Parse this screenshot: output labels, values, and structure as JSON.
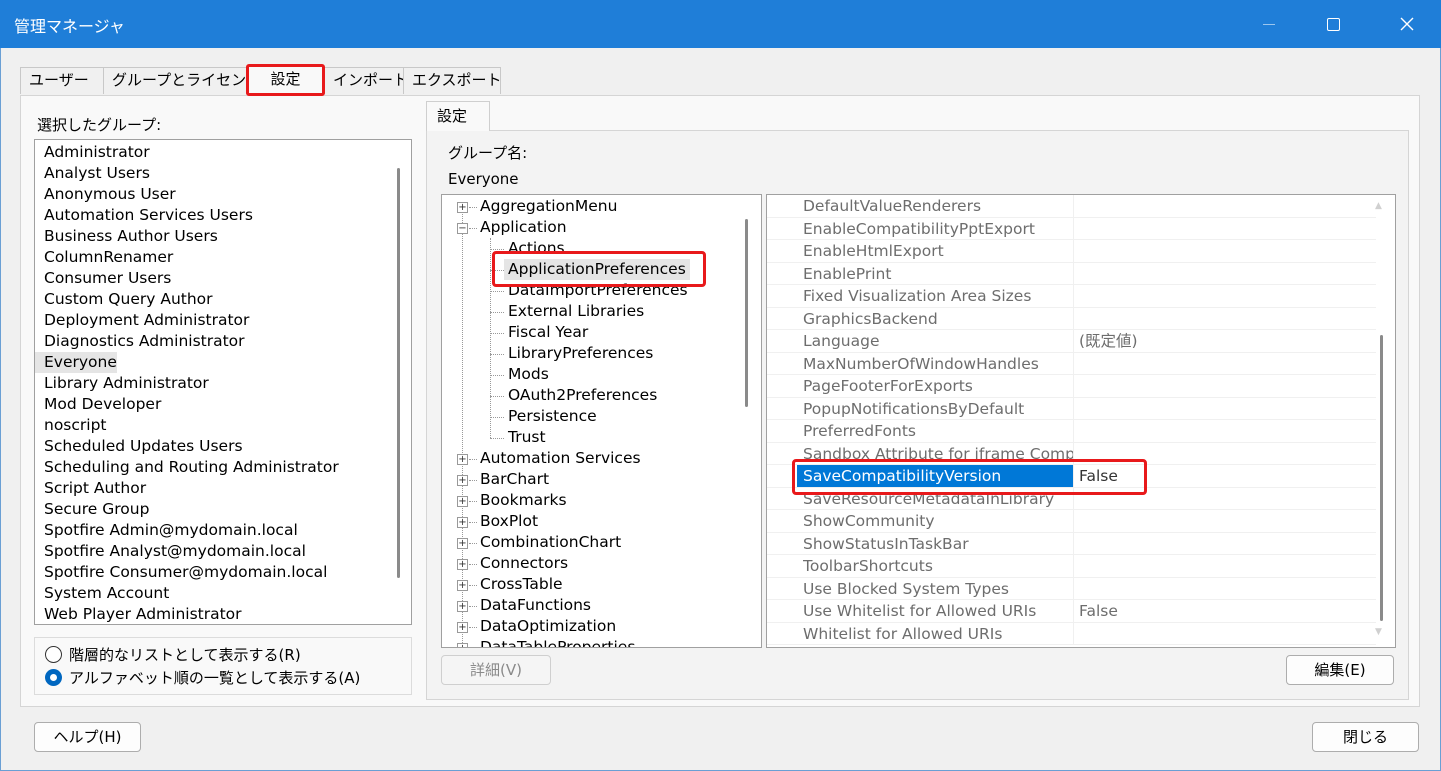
{
  "window": {
    "title": "管理マネージャ"
  },
  "tabs": [
    {
      "label": "ユーザー",
      "active": false
    },
    {
      "label": "グループとライセンス",
      "active": false
    },
    {
      "label": "設定",
      "active": true
    },
    {
      "label": "インポート",
      "active": false
    },
    {
      "label": "エクスポート",
      "active": false
    }
  ],
  "left": {
    "selected_groups_label": "選択したグループ:",
    "groups": [
      "Administrator",
      "Analyst Users",
      "Anonymous User",
      "Automation Services Users",
      "Business Author Users",
      "ColumnRenamer",
      "Consumer Users",
      "Custom Query Author",
      "Deployment Administrator",
      "Diagnostics Administrator",
      "Everyone",
      "Library Administrator",
      "Mod Developer",
      "noscript",
      "Scheduled Updates Users",
      "Scheduling and Routing Administrator",
      "Script Author",
      "Secure Group",
      "Spotfire Admin@mydomain.local",
      "Spotfire Analyst@mydomain.local",
      "Spotfire Consumer@mydomain.local",
      "System Account",
      "Web Player Administrator"
    ],
    "selected_group": "Everyone",
    "radio_hierarchical": "階層的なリストとして表示する(R)",
    "radio_alphabetical": "アルファベット順の一覧として表示する(A)",
    "radio_selected": "alphabetical"
  },
  "settings": {
    "tab_label": "設定",
    "group_name_label": "グループ名:",
    "group_name_value": "Everyone",
    "tree": {
      "aggregation_menu": "AggregationMenu",
      "application": "Application",
      "actions": "Actions",
      "application_preferences": "ApplicationPreferences",
      "data_import_preferences": "DataImportPreferences",
      "external_libraries": "External Libraries",
      "fiscal_year": "Fiscal Year",
      "library_preferences": "LibraryPreferences",
      "mods": "Mods",
      "oauth2_preferences": "OAuth2Preferences",
      "persistence": "Persistence",
      "trust": "Trust",
      "automation_services": "Automation Services",
      "bar_chart": "BarChart",
      "bookmarks": "Bookmarks",
      "box_plot": "BoxPlot",
      "combination_chart": "CombinationChart",
      "connectors": "Connectors",
      "cross_table": "CrossTable",
      "data_functions": "DataFunctions",
      "data_optimization": "DataOptimization",
      "data_table_properties": "DataTableProperties"
    },
    "tree_expanded": "Application",
    "tree_selected": "ApplicationPreferences",
    "properties": [
      {
        "name": "DefaultValueRenderers",
        "value": ""
      },
      {
        "name": "EnableCompatibilityPptExport",
        "value": ""
      },
      {
        "name": "EnableHtmlExport",
        "value": ""
      },
      {
        "name": "EnablePrint",
        "value": ""
      },
      {
        "name": "Fixed Visualization Area Sizes",
        "value": ""
      },
      {
        "name": "GraphicsBackend",
        "value": ""
      },
      {
        "name": "Language",
        "value": "(既定値)"
      },
      {
        "name": "MaxNumberOfWindowHandles",
        "value": ""
      },
      {
        "name": "PageFooterForExports",
        "value": ""
      },
      {
        "name": "PopupNotificationsByDefault",
        "value": ""
      },
      {
        "name": "PreferredFonts",
        "value": ""
      },
      {
        "name": "Sandbox Attribute for iframe Comp",
        "value": ""
      },
      {
        "name": "SaveCompatibilityVersion",
        "value": "False"
      },
      {
        "name": "SaveResourceMetadataInLibrary",
        "value": ""
      },
      {
        "name": "ShowCommunity",
        "value": ""
      },
      {
        "name": "ShowStatusInTaskBar",
        "value": ""
      },
      {
        "name": "ToolbarShortcuts",
        "value": ""
      },
      {
        "name": "Use Blocked System Types",
        "value": ""
      },
      {
        "name": "Use Whitelist for Allowed URIs",
        "value": "False"
      },
      {
        "name": "Whitelist for Allowed URIs",
        "value": ""
      }
    ],
    "selected_property": "SaveCompatibilityVersion",
    "details_button": "詳細(V)",
    "edit_button": "編集(E)"
  },
  "footer": {
    "help_button": "ヘルプ(H)",
    "close_button": "閉じる"
  },
  "colors": {
    "titlebar": "#1f7ed8",
    "selection": "#0078d7",
    "annotation": "#e8191b"
  }
}
